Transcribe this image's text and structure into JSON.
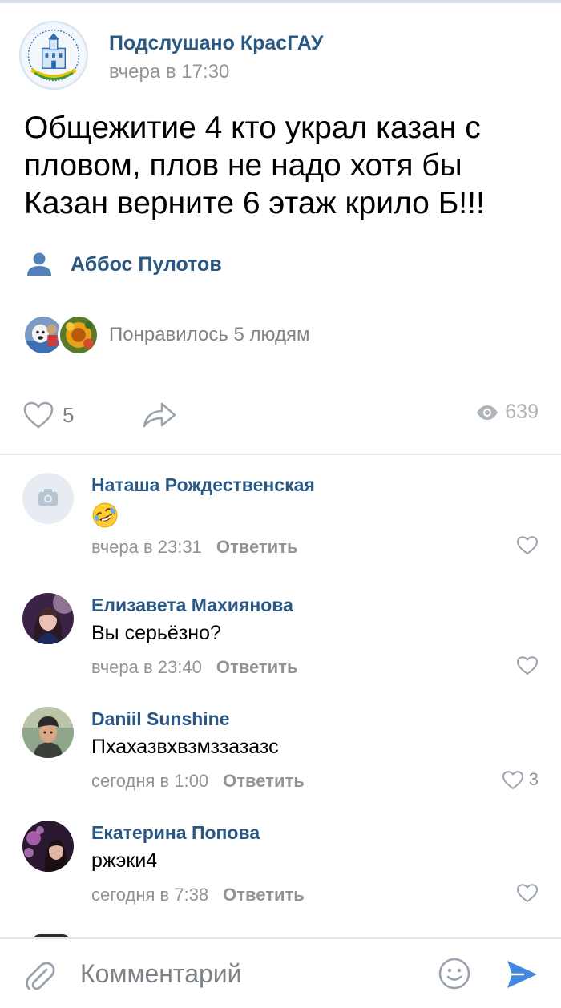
{
  "post": {
    "community_name": "Подслушано КрасГАУ",
    "time": "вчера в 17:30",
    "text": "Общежитие 4 кто украл казан с\nпловом,  плов не надо  хотя бы\nКазан верните 6 этаж крило Б!!!",
    "author": "Аббос Пулотов",
    "likes_text": "Понравилось 5 людям",
    "like_count": "5",
    "view_count": "639"
  },
  "comments": [
    {
      "name": "Наташа Рождественская",
      "text": "",
      "emoji": "rofl",
      "time": "вчера в 23:31",
      "reply": "Ответить",
      "likes": ""
    },
    {
      "name": "Елизавета Махиянова",
      "text": "Вы серьёзно?",
      "time": "вчера в 23:40",
      "reply": "Ответить",
      "likes": ""
    },
    {
      "name": "Daniil Sunshine",
      "text": "Пхахазвхвзмззазазс",
      "time": "сегодня в 1:00",
      "reply": "Ответить",
      "likes": "3"
    },
    {
      "name": "Екатерина Попова",
      "text": "ржэки4",
      "time": "сегодня в 7:38",
      "reply": "Ответить",
      "likes": ""
    }
  ],
  "composer": {
    "placeholder": "Комментарий"
  },
  "colors": {
    "link": "#2a5885",
    "meta": "#939393",
    "accent": "#3f8ae0"
  },
  "icons": [
    "community-logo-icon",
    "user-icon",
    "heart-icon",
    "share-icon",
    "eye-icon",
    "camera-icon",
    "attach-icon",
    "smile-icon",
    "send-icon"
  ]
}
